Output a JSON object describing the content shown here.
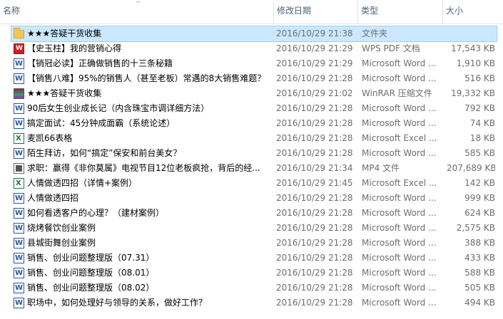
{
  "columns": {
    "name": "名称",
    "date": "修改日期",
    "type": "类型",
    "size": "大小"
  },
  "files": [
    {
      "name": "★★★答疑干货收集",
      "date": "2016/10/29 21:38",
      "type": "文件夹",
      "size": "",
      "icon": "folder-icon",
      "selected": true
    },
    {
      "name": "【史玉柱】我的营销心得",
      "date": "2016/10/29 21:29",
      "type": "WPS PDF 文档",
      "size": "17,543 KB",
      "icon": "pdf-icon"
    },
    {
      "name": "【销冠必读】正确做销售的十三条秘籍",
      "date": "2016/10/29 21:29",
      "type": "Microsoft Word ...",
      "size": "1,910 KB",
      "icon": "word-icon"
    },
    {
      "name": "【销售八难】95%的销售人（甚至老板）常遇的8大销售难题？",
      "date": "2016/10/29 21:28",
      "type": "Microsoft Word ...",
      "size": "516 KB",
      "icon": "word-icon"
    },
    {
      "name": "★★★答疑干货收集",
      "date": "2016/10/29 21:02",
      "type": "WinRAR 压缩文件",
      "size": "19,332 KB",
      "icon": "rar-icon"
    },
    {
      "name": "90后女生创业成长记（内含珠宝市调详细方法）",
      "date": "2016/10/29 21:28",
      "type": "Microsoft Word ...",
      "size": "792 KB",
      "icon": "word-icon"
    },
    {
      "name": "搞定面试：45分钟成面霸（系统论述）",
      "date": "2016/10/29 21:28",
      "type": "Microsoft Word ...",
      "size": "74 KB",
      "icon": "word-icon"
    },
    {
      "name": "麦凯66表格",
      "date": "2016/10/29 21:28",
      "type": "Microsoft Excel ...",
      "size": "18 KB",
      "icon": "excel-icon"
    },
    {
      "name": "陌生拜访，如何“搞定”保安和前台美女？",
      "date": "2016/10/29 21:28",
      "type": "Microsoft Word ...",
      "size": "585 KB",
      "icon": "word-icon"
    },
    {
      "name": "求职：赢得《非你莫属》电视节目12位老板疯抢，背后的经...",
      "date": "2016/10/29 21:34",
      "type": "MP4 文件",
      "size": "207,689 KB",
      "icon": "video-icon"
    },
    {
      "name": "人情做透四招（详情+案例）",
      "date": "2016/10/29 21:45",
      "type": "Microsoft Excel ...",
      "size": "142 KB",
      "icon": "excel-icon"
    },
    {
      "name": "人情做透四招",
      "date": "2016/10/29 21:28",
      "type": "Microsoft Word ...",
      "size": "999 KB",
      "icon": "word-icon"
    },
    {
      "name": "如何看透客户的心理？（建材案例）",
      "date": "2016/10/29 21:28",
      "type": "Microsoft Word ...",
      "size": "624 KB",
      "icon": "word-icon"
    },
    {
      "name": "烧烤餐饮创业案例",
      "date": "2016/10/29 21:28",
      "type": "Microsoft Word ...",
      "size": "2,575 KB",
      "icon": "word-icon"
    },
    {
      "name": "县城街舞创业案例",
      "date": "2016/10/29 21:28",
      "type": "Microsoft Word ...",
      "size": "388 KB",
      "icon": "word-icon"
    },
    {
      "name": "销售、创业问题整理版（07.31）",
      "date": "2016/10/29 21:28",
      "type": "Microsoft Word ...",
      "size": "433 KB",
      "icon": "word-icon"
    },
    {
      "name": "销售、创业问题整理版（08.01）",
      "date": "2016/10/29 21:28",
      "type": "Microsoft Word ...",
      "size": "588 KB",
      "icon": "word-icon"
    },
    {
      "name": "销售、创业问题整理版（08.02）",
      "date": "2016/10/29 21:28",
      "type": "Microsoft Word ...",
      "size": "505 KB",
      "icon": "word-icon"
    },
    {
      "name": "职场中，如何处理好与领导的关系，做好工作？",
      "date": "2016/10/29 21:28",
      "type": "Microsoft Word ...",
      "size": "494 KB",
      "icon": "word-icon"
    }
  ]
}
